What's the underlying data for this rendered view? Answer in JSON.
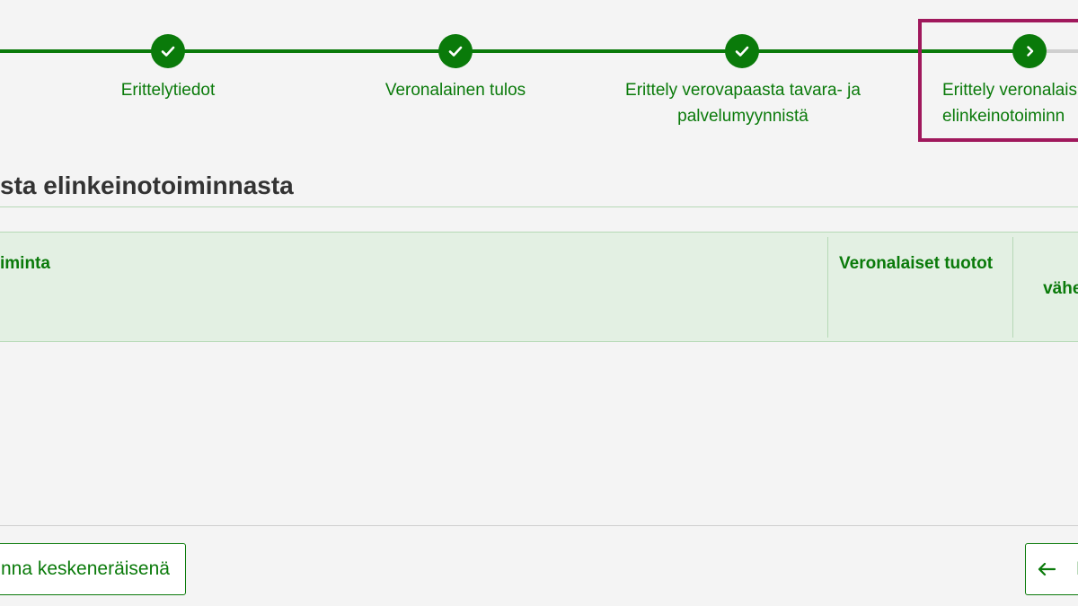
{
  "stepper": {
    "steps": [
      {
        "label": "Erittelytiedot",
        "state": "completed"
      },
      {
        "label": "Veronalainen tulos",
        "state": "completed"
      },
      {
        "label": "Erittely verovapaasta tavara- ja palvelumyynnistä",
        "state": "completed"
      },
      {
        "label": "Erittely veronalais elinkeinotoiminn",
        "state": "current"
      }
    ],
    "colors": {
      "accent": "#0a7a0a",
      "current_frame": "#a0185c",
      "pending_line": "#cfcfcf"
    }
  },
  "section": {
    "title": "sta elinkeinotoiminnasta"
  },
  "table": {
    "columns": [
      "iminta",
      "Veronalaiset tuotot",
      "V\nvähen"
    ]
  },
  "footer": {
    "save_draft_label": "nna keskeneräisenä",
    "back_icon": "arrow-left-icon",
    "back_label": "E"
  }
}
